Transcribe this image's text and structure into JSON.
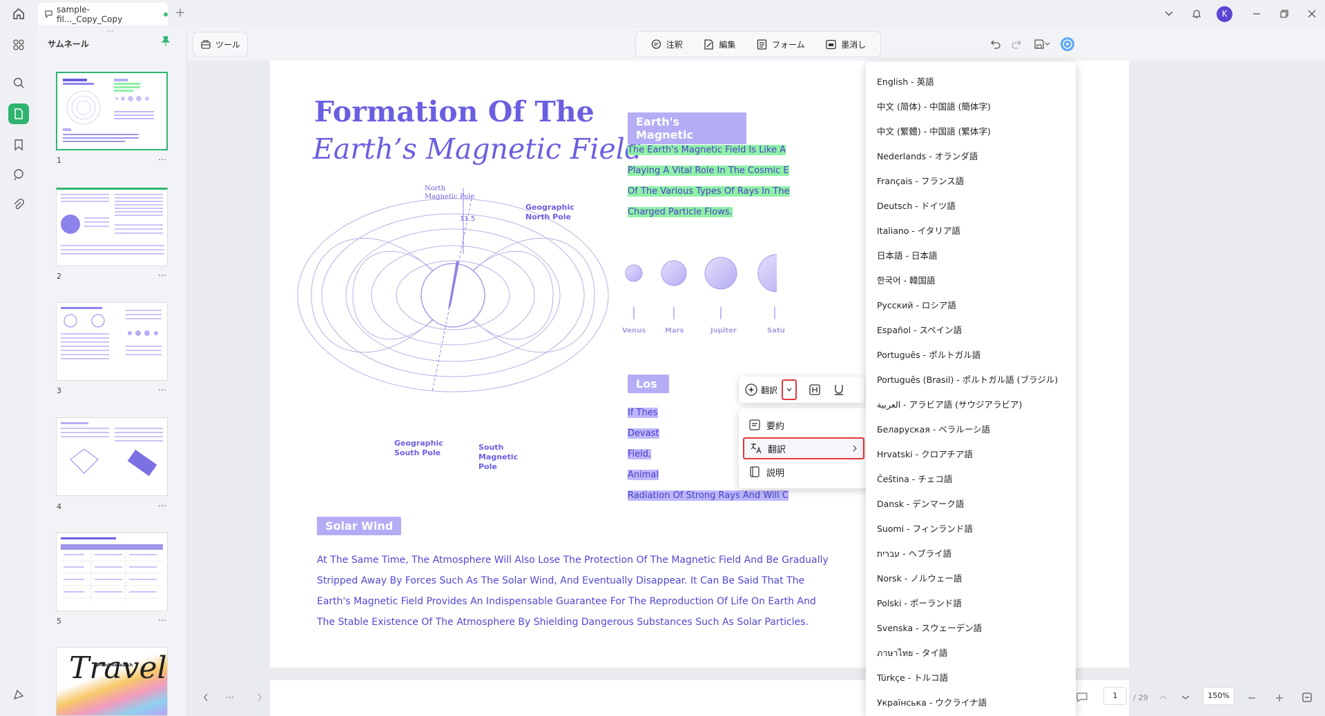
{
  "titlebar": {
    "tab_label": "sample-fil..._Copy_Copy",
    "new_tab": "+",
    "avatar_letter": "K"
  },
  "thumbnails": {
    "title": "サムネール",
    "pages": [
      {
        "number": "1",
        "more": "⋯"
      },
      {
        "number": "2",
        "more": "⋯"
      },
      {
        "number": "3",
        "more": "⋯"
      },
      {
        "number": "4",
        "more": "⋯"
      },
      {
        "number": "5",
        "more": "⋯"
      }
    ],
    "page6_text": "Travel",
    "page6_sub": "Trend Research"
  },
  "toolbar": {
    "tools_label": "ツール",
    "modes": [
      {
        "label": "注釈",
        "icon": "comment-icon"
      },
      {
        "label": "編集",
        "icon": "edit-icon"
      },
      {
        "label": "フォーム",
        "icon": "form-icon"
      },
      {
        "label": "墨消し",
        "icon": "redact-icon"
      }
    ]
  },
  "document": {
    "title_line1": "Formation Of The",
    "title_line2": "Earth’s Magnetic Field",
    "diagram_labels": {
      "north_magnetic": [
        "North",
        "Magnetic Pole"
      ],
      "geo_north": [
        "Geographic",
        "North Pole"
      ],
      "geo_south": [
        "Geographic",
        "South Pole"
      ],
      "south_magnetic": [
        "South",
        "Magnetic",
        "Pole"
      ],
      "angle": "11.5"
    },
    "magnetic_label": "Earth's Magnetic",
    "magnetic_lines": [
      "The Earth's Magnetic Field Is Like A",
      "Playing A Vital Role In The Cosmic E",
      "Of The Various Types Of Rays In The",
      "Charged Particle Flows."
    ],
    "planets": [
      "Venus",
      "Mars",
      "Jupiter",
      "Satu"
    ],
    "loss_label": "Los",
    "loss_lines": [
      "If Thes",
      "Devast",
      "Field, ",
      "Animal",
      "Radiation Of Strong Rays And Will C"
    ],
    "solar_label": "Solar Wind",
    "solar_lines": [
      "At The Same Time, The Atmosphere Will Also Lose The Protection Of The Magnetic Field And Be Gradually",
      "Stripped Away By Forces Such As The Solar Wind, And Eventually Disappear. It Can Be Said That The",
      "Earth's Magnetic Field Provides An Indispensable Guarantee For The Reproduction Of Life On Earth And",
      "The Stable Existence Of The Atmosphere By Shielding Dangerous Substances Such As Solar Particles."
    ]
  },
  "floatbar": {
    "translate_label": "翻訳"
  },
  "ai_menu": [
    {
      "label": "要約"
    },
    {
      "label": "翻訳"
    },
    {
      "label": "説明"
    }
  ],
  "languages": [
    "English - 英語",
    "中文 (简体) - 中国語 (簡体字)",
    "中文 (繁體) - 中国語 (繁体字)",
    "Nederlands - オランダ語",
    "Français - フランス語",
    "Deutsch - ドイツ語",
    "Italiano - イタリア語",
    "日本語 - 日本語",
    "한국어 - 韓国語",
    "Русский - ロシア語",
    "Español - スペイン語",
    "Português - ポルトガル語",
    "Português (Brasil) - ポルトガル語 (ブラジル)",
    "العربية - アラビア語 (サウジアラビア)",
    "Беларуская - ベラルーシ語",
    "Hrvatski - クロアチア語",
    "Čeština - チェコ語",
    "Dansk - デンマーク語",
    "Suomi - フィンランド語",
    "עברית - ヘブライ語",
    "Norsk - ノルウェー語",
    "Polski - ポーランド語",
    "Svenska - スウェーデン語",
    "ภาษาไทย - タイ語",
    "Türkçe - トルコ語",
    "Українська - ウクライナ語"
  ],
  "bottombar": {
    "more": "⋯",
    "current_page": "1",
    "total_pages": "/ 29",
    "zoom": "150%",
    "zoom_out": "−",
    "zoom_in": "+"
  }
}
